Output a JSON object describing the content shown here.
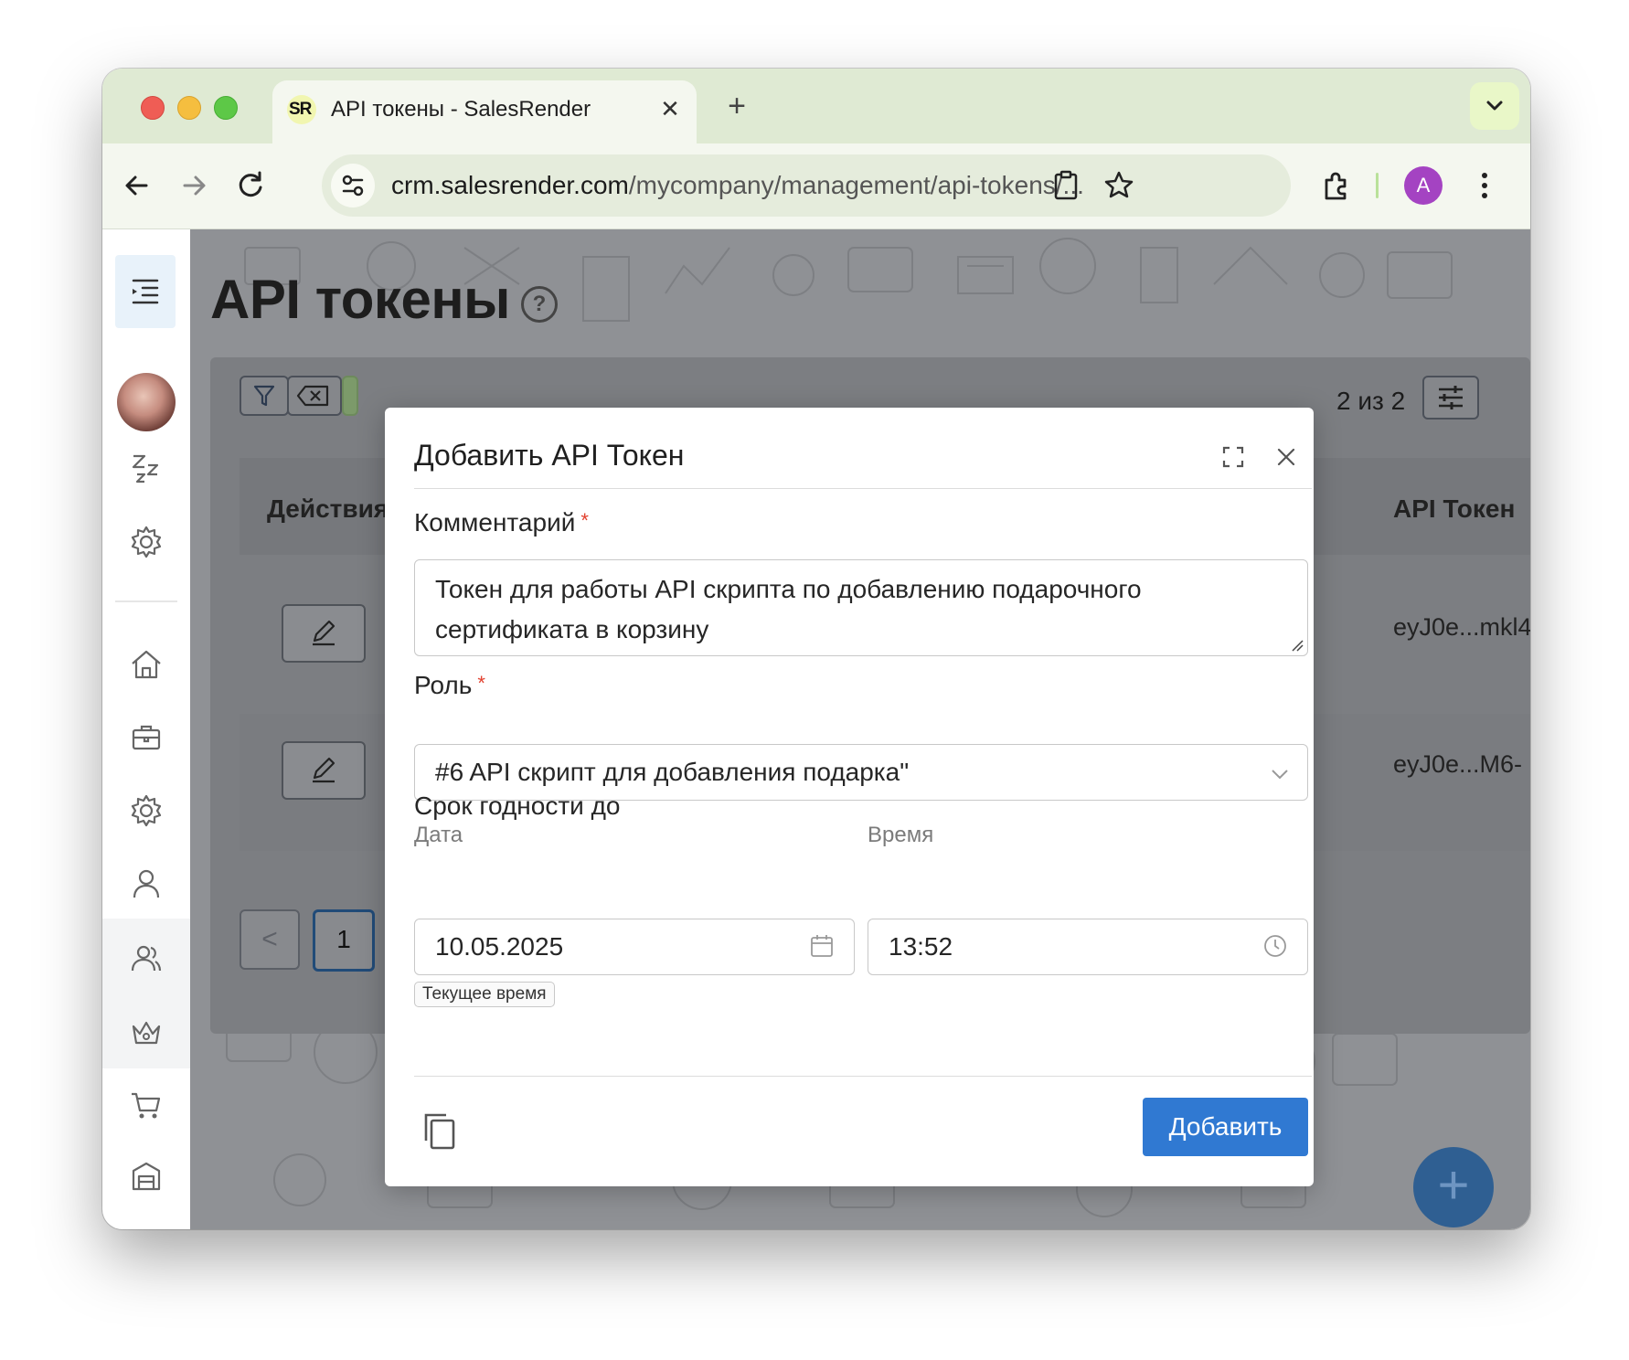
{
  "browser": {
    "tab_title": "API токены - SalesRender",
    "favicon_text": "SR",
    "new_tab": "+",
    "close_tab": "✕",
    "url_host": "crm.salesrender.com",
    "url_path": "/mycompany/management/api-tokens/...",
    "profile_initial": "A",
    "accent_color": "#dfead3"
  },
  "sidebar": {
    "icons": [
      "menu-icon",
      "avatar",
      "sleep-icon",
      "gear-icon",
      "home-icon",
      "briefcase-icon",
      "settings-icon",
      "user-icon",
      "users-icon",
      "crown-icon",
      "cart-icon",
      "warehouse-icon"
    ]
  },
  "page": {
    "title": "API токены",
    "help": "?",
    "pager_count": "2 из 2",
    "table": {
      "header_actions": "Действия",
      "header_token": "API Токен",
      "rows": [
        {
          "token": "eyJ0e...mkl4"
        },
        {
          "token": "eyJ0e...M6-"
        }
      ]
    },
    "pagination": {
      "prev": "<",
      "current": "1"
    },
    "fab": "+"
  },
  "modal": {
    "title": "Добавить API Токен",
    "comment_label": "Комментарий",
    "comment_value": "Токен для работы API скрипта по добавлению подарочного сертификата в корзину",
    "role_label": "Роль",
    "role_value": "#6 API скрипт для добавления подарка\"",
    "expiry_label": "Срок годности до",
    "date_label": "Дата",
    "date_value": "10.05.2025",
    "time_label": "Время",
    "time_value": "13:52",
    "now_button": "Текущее время",
    "submit_button": "Добавить",
    "required_mark": "*",
    "primary_color": "#3079d2"
  }
}
